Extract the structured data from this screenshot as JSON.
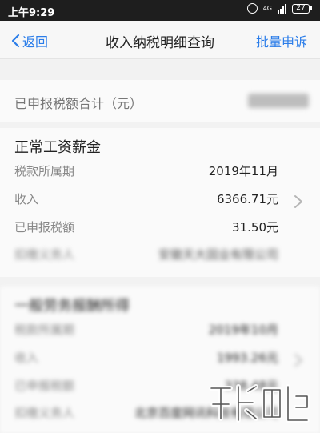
{
  "status_bar": {
    "time": "上午9:29",
    "signal_label": "4G",
    "battery": "27"
  },
  "nav": {
    "back_label": "返回",
    "title": "收入纳税明细查询",
    "batch_label": "批量申诉"
  },
  "summary": {
    "label": "已申报税额合计（元）"
  },
  "records": [
    {
      "title": "正常工资薪金",
      "rows": [
        {
          "label": "税款所属期",
          "value": "2019年11月"
        },
        {
          "label": "收入",
          "value": "6366.71元"
        },
        {
          "label": "已申报税额",
          "value": "31.50元"
        },
        {
          "label": "扣缴义务人",
          "value": "安徽天大固业有限公司"
        }
      ]
    },
    {
      "title": "一般劳务报酬所得",
      "rows": [
        {
          "label": "税款所属期",
          "value": "2019年10月"
        },
        {
          "label": "收入",
          "value": "1993.26元"
        },
        {
          "label": "已申报税额",
          "value": "338.48元"
        },
        {
          "label": "扣缴义务人",
          "value": "北京百度网讯科技有限公司"
        }
      ]
    }
  ],
  "colors": {
    "accent": "#2b7de9",
    "status_bar": "#1e1e1e",
    "background": "#f2f2f2"
  },
  "icons": {
    "back": "chevron-left-icon",
    "alarm": "alarm-icon",
    "signal": "signal-bars-icon",
    "battery": "battery-icon",
    "detail": "chevron-right-icon"
  }
}
